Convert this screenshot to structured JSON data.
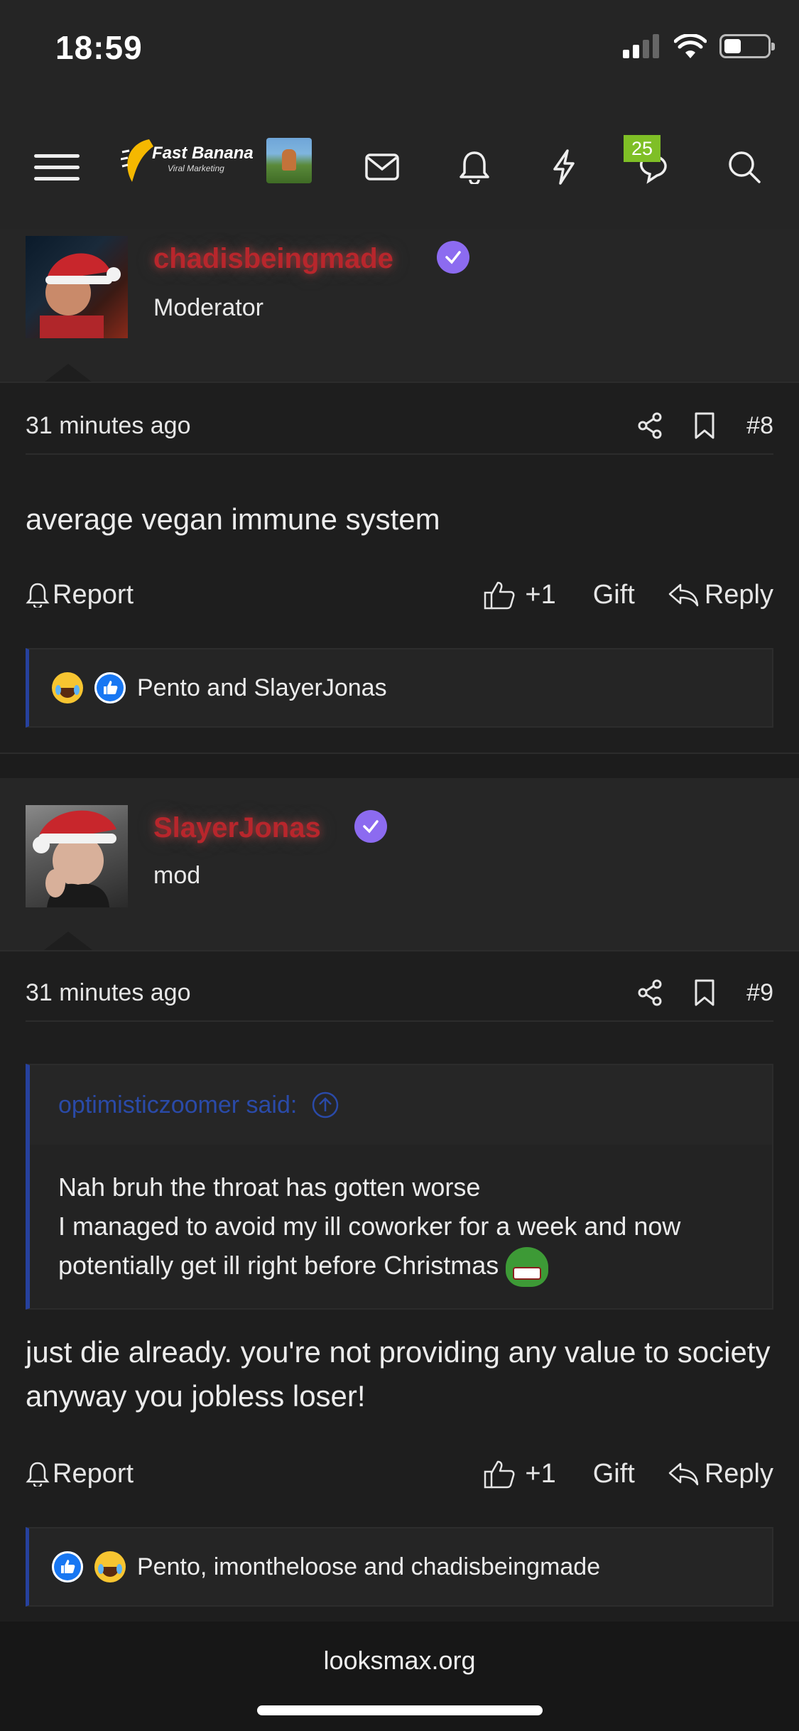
{
  "status_bar": {
    "time": "18:59",
    "battery_level": 0.4
  },
  "nav": {
    "logo_text": "Fast Banana",
    "logo_sub": "Viral Marketing",
    "messages_badge": "25"
  },
  "posts": [
    {
      "username": "chadisbeingmade",
      "role": "Moderator",
      "time": "31 minutes ago",
      "number": "#8",
      "body": "average vegan immune system",
      "actions": {
        "report": "Report",
        "like": "+1",
        "gift": "Gift",
        "reply": "Reply"
      },
      "reactions_text": "Pento and SlayerJonas"
    },
    {
      "username": "SlayerJonas",
      "role": "mod",
      "time": "31 minutes ago",
      "number": "#9",
      "quote": {
        "author_line": "optimisticzoomer said:",
        "line1": "Nah bruh the throat has gotten worse",
        "line2": "I managed to avoid my ill coworker for a week and now potentially get ill right before Christmas"
      },
      "body": "just die already. you're not providing any value to society anyway you jobless loser!",
      "actions": {
        "report": "Report",
        "like": "+1",
        "gift": "Gift",
        "reply": "Reply"
      },
      "reactions_text": "Pento, imontheloose and chadisbeingmade"
    }
  ],
  "browser": {
    "url": "looksmax.org"
  },
  "colors": {
    "username": "#b8262c",
    "verified": "#8c6bf0",
    "quote_accent": "#26419e",
    "badge": "#7fbf26"
  }
}
